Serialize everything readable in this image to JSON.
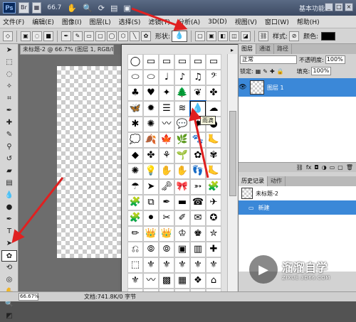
{
  "titlebar": {
    "logo": "Ps",
    "bridge": "Br",
    "zoom": "66.7",
    "workspace": "基本功能",
    "win_min": "_",
    "win_max": "□",
    "win_close": "×"
  },
  "menu": [
    "文件(F)",
    "编辑(E)",
    "图像(I)",
    "图层(L)",
    "选择(S)",
    "滤镜(T)",
    "分析(A)",
    "3D(D)",
    "视图(V)",
    "窗口(W)",
    "帮助(H)"
  ],
  "options": {
    "shape_label": "形状:",
    "shape_current": "💧",
    "style_label": "样式:",
    "color_label": "颜色:",
    "color_value": "#000000"
  },
  "document": {
    "tab_title": "未标题-2 @ 66.7% (图层 1, RGB/8)"
  },
  "shape_picker": {
    "tooltip": "雨滴",
    "shapes": [
      "◯",
      "▭",
      "▭",
      "▭",
      "▭",
      "▭",
      "⬭",
      "⬭",
      "♩",
      "♪",
      "♫",
      "𝄢",
      "♣",
      "♥",
      "✦",
      "🌲",
      "❦",
      "✤",
      "🦋",
      "✹",
      "☰",
      "≋",
      "💧",
      "☁",
      "✱",
      "✺",
      "〰",
      "💬",
      "✸",
      "●",
      "💭",
      "🍂",
      "🍁",
      "🌿",
      "🐾",
      "🦶",
      "◆",
      "✤",
      "⚘",
      "🌱",
      "✿",
      "✾",
      "✺",
      "💡",
      "✋",
      "✋",
      "👣",
      "🦶",
      "☂",
      "➤",
      "🗝",
      "🎀",
      "➳",
      "🧩",
      "🧩",
      "⧉",
      "✒",
      "▬",
      "☎",
      "✈",
      "🧩",
      "⚫",
      "✂",
      "✐",
      "✉",
      "✪",
      "✏",
      "👑",
      "👑",
      "♔",
      "♚",
      "✮",
      "⎌",
      "⦾",
      "⦾",
      "▣",
      "▥",
      "✚",
      "⬚",
      "⚜",
      "⚜",
      "⚜",
      "⚜",
      "⚜",
      "⚜",
      "〰",
      "▩",
      "▦",
      "❖",
      "⌂",
      "⚜",
      "✿",
      "⚜",
      "⚜",
      "⚜",
      "⚜"
    ]
  },
  "right_panel": {
    "layers_tabs": [
      "图层",
      "通道",
      "路径"
    ],
    "blend_mode": "正常",
    "opacity_label": "不透明度:",
    "opacity": "100%",
    "lock_label": "锁定:",
    "fill_label": "填充:",
    "fill": "100%",
    "layer_name": "图层 1",
    "history_tabs": [
      "历史记录",
      "动作"
    ],
    "history_doc": "未标题-2",
    "history_step": "新建"
  },
  "status": {
    "zoom": "66.67%",
    "doc_info": "文档:741.8K/0 字节"
  },
  "watermark": {
    "name": "溜溜自学",
    "url": "ZIXUE.3D66.COM"
  },
  "colors": {
    "accent": "#3b88d8",
    "arrow": "#e02020"
  }
}
